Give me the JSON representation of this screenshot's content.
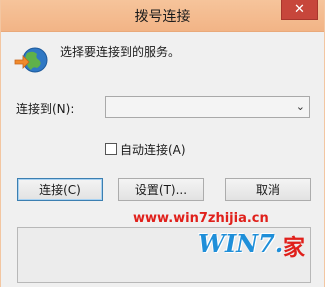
{
  "window": {
    "title": "拨号连接",
    "close_icon": "close-icon"
  },
  "prompt": {
    "text": "选择要连接到的服务。",
    "icon": "network-globe-icon"
  },
  "connect_to": {
    "label": "连接到(N):",
    "selected_value": "",
    "dropdown_icon": "chevron-down-icon"
  },
  "auto_connect": {
    "label": "自动连接(A)",
    "checked": false
  },
  "buttons": {
    "connect": "连接(C)",
    "settings": "设置(T)...",
    "cancel": "取消"
  },
  "watermark": {
    "url": "www.win7zhijia.cn",
    "brand_text": "WIN7.",
    "brand_home": "家"
  },
  "colors": {
    "titlebar": "#f6c49b",
    "close_button": "#c7463b",
    "watermark_red": "#e0201b",
    "watermark_blue": "#1f8fd9"
  }
}
